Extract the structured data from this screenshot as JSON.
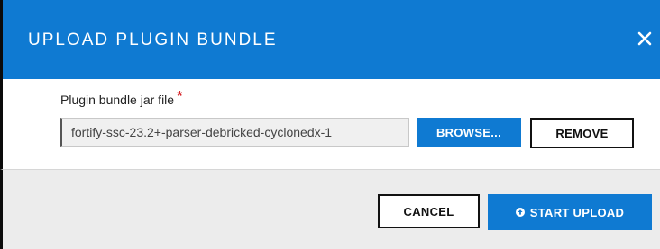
{
  "dialog": {
    "title": "UPLOAD PLUGIN BUNDLE",
    "close_icon": "close-icon",
    "accent_color": "#0f7ad2",
    "required_color": "#d6262b"
  },
  "form": {
    "field_label": "Plugin bundle jar file",
    "required_marker": "*",
    "file_value": "fortify-ssc-23.2+-parser-debricked-cyclonedx-1",
    "browse_label": "BROWSE...",
    "remove_label": "REMOVE"
  },
  "footer": {
    "cancel_label": "CANCEL",
    "start_upload_label": "START UPLOAD",
    "start_upload_icon": "upload-circle-icon"
  }
}
